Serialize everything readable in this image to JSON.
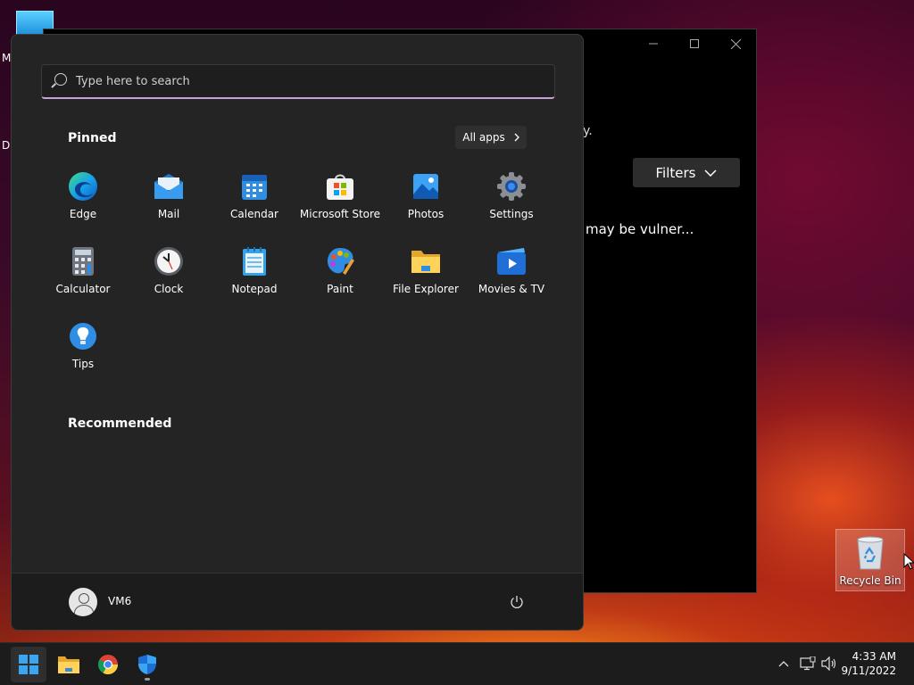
{
  "desktop": {
    "fragment_labels": [
      "M",
      "Da"
    ],
    "recycle_bin_label": "Recycle Bin"
  },
  "background_window": {
    "text_fragment": "y.",
    "filters_label": "Filters",
    "notice_fragment": "may be vulner..."
  },
  "start_menu": {
    "search_placeholder": "Type here to search",
    "pinned_title": "Pinned",
    "all_apps_label": "All apps",
    "pinned_apps": [
      {
        "label": "Edge",
        "icon": "edge-icon"
      },
      {
        "label": "Mail",
        "icon": "mail-icon"
      },
      {
        "label": "Calendar",
        "icon": "calendar-icon"
      },
      {
        "label": "Microsoft Store",
        "icon": "store-icon"
      },
      {
        "label": "Photos",
        "icon": "photos-icon"
      },
      {
        "label": "Settings",
        "icon": "gear-icon"
      },
      {
        "label": "Calculator",
        "icon": "calculator-icon"
      },
      {
        "label": "Clock",
        "icon": "clock-icon"
      },
      {
        "label": "Notepad",
        "icon": "notepad-icon"
      },
      {
        "label": "Paint",
        "icon": "paint-icon"
      },
      {
        "label": "File Explorer",
        "icon": "folder-icon"
      },
      {
        "label": "Movies & TV",
        "icon": "movies-icon"
      },
      {
        "label": "Tips",
        "icon": "lightbulb-icon"
      }
    ],
    "recommended_title": "Recommended",
    "user_name": "VM6"
  },
  "taskbar": {
    "apps": [
      "start-icon",
      "file-explorer-icon",
      "chrome-icon",
      "windows-security-icon"
    ],
    "time": "4:33 AM",
    "date": "9/11/2022"
  },
  "colors": {
    "accent": "#c7a0d8",
    "menu_bg": "#242424",
    "taskbar_bg": "#1c1c1c"
  }
}
